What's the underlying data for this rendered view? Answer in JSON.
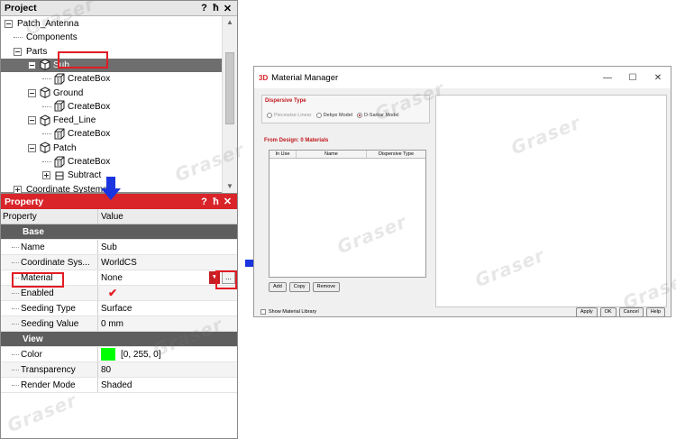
{
  "project_panel": {
    "title": "Project",
    "title_buttons": [
      "?",
      "ħ",
      "✕"
    ],
    "tree": [
      {
        "label": "Patch_Antenna",
        "indent": 0,
        "expander": "minus",
        "icon": "none"
      },
      {
        "label": "Components",
        "indent": 1,
        "expander": "line",
        "icon": "none"
      },
      {
        "label": "Parts",
        "indent": 1,
        "expander": "minus",
        "icon": "none"
      },
      {
        "label": "Sub",
        "indent": 2,
        "expander": "minus",
        "icon": "cube",
        "selected": true
      },
      {
        "label": "CreateBox",
        "indent": 3,
        "expander": "line",
        "icon": "box"
      },
      {
        "label": "Ground",
        "indent": 2,
        "expander": "minus",
        "icon": "cube"
      },
      {
        "label": "CreateBox",
        "indent": 3,
        "expander": "line",
        "icon": "box"
      },
      {
        "label": "Feed_Line",
        "indent": 2,
        "expander": "minus",
        "icon": "cube"
      },
      {
        "label": "CreateBox",
        "indent": 3,
        "expander": "line",
        "icon": "box"
      },
      {
        "label": "Patch",
        "indent": 2,
        "expander": "minus",
        "icon": "cube"
      },
      {
        "label": "CreateBox",
        "indent": 3,
        "expander": "line",
        "icon": "box"
      },
      {
        "label": "Subtract",
        "indent": 3,
        "expander": "plus",
        "icon": "subtract"
      },
      {
        "label": "Coordinate Systems",
        "indent": 1,
        "expander": "plus",
        "icon": "none"
      }
    ]
  },
  "property_panel": {
    "title": "Property",
    "title_buttons": [
      "?",
      "ħ",
      "✕"
    ],
    "header": {
      "property": "Property",
      "value": "Value"
    },
    "group_base": "Base",
    "name": {
      "label": "Name",
      "value": "Sub"
    },
    "coordinate_system": {
      "label": "Coordinate Sys...",
      "value": "WorldCS"
    },
    "material": {
      "label": "Material",
      "value": "None",
      "button": "..."
    },
    "enabled": {
      "label": "Enabled",
      "value": "✔"
    },
    "seeding_type": {
      "label": "Seeding Type",
      "value": "Surface"
    },
    "seeding_value": {
      "label": "Seeding Value",
      "value": "0 mm"
    },
    "group_view": "View",
    "color": {
      "label": "Color",
      "value": "[0, 255, 0]",
      "swatch": "#00ff00"
    },
    "transparency": {
      "label": "Transparency",
      "value": "80"
    },
    "render_mode": {
      "label": "Render Mode",
      "value": "Shaded"
    }
  },
  "material_manager": {
    "logo": "3D",
    "title": "Material Manager",
    "window_controls": [
      "—",
      "☐",
      "✕"
    ],
    "dispersive_type": {
      "title": "Dispersive Type",
      "options": [
        {
          "label": "Piecewise Linear",
          "checked": false,
          "disabled": true
        },
        {
          "label": "Debye Model",
          "checked": false,
          "disabled": false
        },
        {
          "label": "D-Sarkar Model",
          "checked": true,
          "disabled": false
        }
      ]
    },
    "from_design": {
      "title": "From Design: 0 Materials",
      "columns": [
        "In Use",
        "Name",
        "Dispersive Type"
      ]
    },
    "buttons": {
      "add": "Add",
      "copy": "Copy",
      "remove": "Remove"
    },
    "show_library": "Show Material Library",
    "footer": {
      "apply": "Apply",
      "ok": "OK",
      "cancel": "Cancel",
      "help": "Help"
    }
  },
  "watermark": "Graser",
  "colors": {
    "accent_red": "#d9242a",
    "selection": "#6e6e6e",
    "arrow_blue": "#1a35e0"
  }
}
